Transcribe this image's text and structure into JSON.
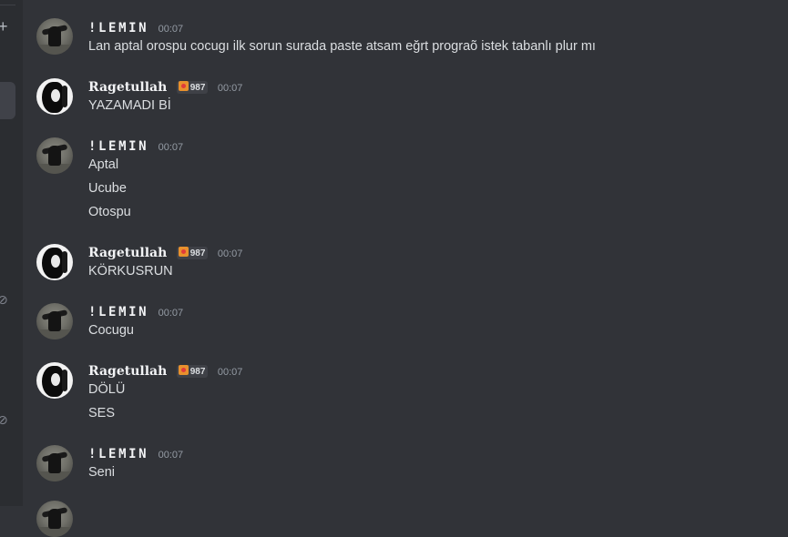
{
  "sidebar": {
    "add_glyph": "+",
    "channel_icon": "⊘"
  },
  "messages": [
    {
      "author": "!LEMIN",
      "time": "00:07",
      "lines": [
        "Lan aptal orospu cocugı ilk sorun surada paste atsam eğrt prograõ istek tabanlı plur mı"
      ]
    },
    {
      "author": "Ragetullah",
      "tag": "987",
      "time": "00:07",
      "lines": [
        "YAZAMADI Bİ"
      ]
    },
    {
      "author": "!LEMIN",
      "time": "00:07",
      "lines": [
        "Aptal",
        "Ucube",
        "Otospu"
      ]
    },
    {
      "author": "Ragetullah",
      "tag": "987",
      "time": "00:07",
      "lines": [
        "KÖRKUSRUN"
      ]
    },
    {
      "author": "!LEMIN",
      "time": "00:07",
      "lines": [
        "Cocugu"
      ]
    },
    {
      "author": "Ragetullah",
      "tag": "987",
      "time": "00:07",
      "lines": [
        "DÖLÜ",
        "SES"
      ]
    },
    {
      "author": "!LEMIN",
      "time": "00:07",
      "lines": [
        "Seni"
      ]
    }
  ]
}
